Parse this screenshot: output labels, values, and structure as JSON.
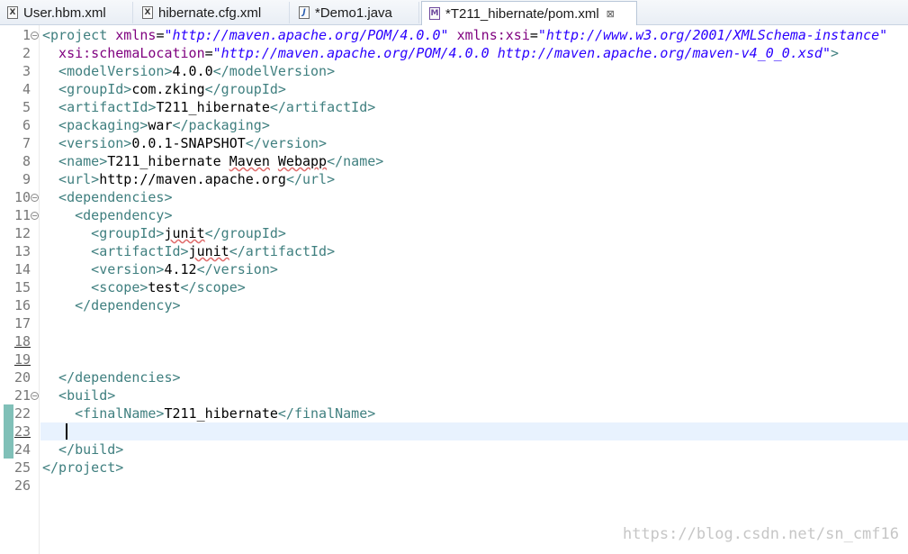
{
  "tabs": [
    {
      "icon": "xml-file-icon",
      "label": "User.hbm.xml"
    },
    {
      "icon": "xml-file-icon",
      "label": "hibernate.cfg.xml"
    },
    {
      "icon": "java-file-icon",
      "label": "*Demo1.java"
    },
    {
      "icon": "maven-pom-icon",
      "label": "*T211_hibernate/pom.xml",
      "active": true,
      "close": "⊠"
    }
  ],
  "line_numbers": [
    "1",
    "2",
    "3",
    "4",
    "5",
    "6",
    "7",
    "8",
    "9",
    "10",
    "11",
    "12",
    "13",
    "14",
    "15",
    "16",
    "17",
    "18",
    "19",
    "20",
    "21",
    "22",
    "23",
    "24",
    "25",
    "26"
  ],
  "code": {
    "l1": {
      "t1": "<project ",
      "a1": "xmlns",
      "e1": "=",
      "v1": "\"http://maven.apache.org/POM/4.0.0\"",
      "a2": " xmlns:xsi",
      "e2": "=",
      "v2": "\"http://www.w3.org/2001/XMLSchema-instance\""
    },
    "l2": {
      "a": "  xsi:schemaLocation",
      "e": "=",
      "v": "\"http://maven.apache.org/POM/4.0.0 http://maven.apache.org/maven-v4_0_0.xsd\"",
      "t": ">"
    },
    "l3": {
      "o": "  <modelVersion>",
      "x": "4.0.0",
      "c": "</modelVersion>"
    },
    "l4": {
      "o": "  <groupId>",
      "x": "com.zking",
      "c": "</groupId>"
    },
    "l5": {
      "o": "  <artifactId>",
      "x": "T211_hibernate",
      "c": "</artifactId>"
    },
    "l6": {
      "o": "  <packaging>",
      "x": "war",
      "c": "</packaging>"
    },
    "l7": {
      "o": "  <version>",
      "x": "0.0.1-SNAPSHOT",
      "c": "</version>"
    },
    "l8": {
      "o": "  <name>",
      "x1": "T211_hibernate ",
      "x2": "Maven",
      "x3": " ",
      "x4": "Webapp",
      "c": "</name>"
    },
    "l9": {
      "o": "  <url>",
      "x": "http://maven.apache.org",
      "c": "</url>"
    },
    "l10": {
      "o": "  <dependencies>"
    },
    "l11": {
      "o": "    <dependency>"
    },
    "l12": {
      "o": "      <groupId>",
      "x": "junit",
      "c": "</groupId>"
    },
    "l13": {
      "o": "      <artifactId>",
      "x": "junit",
      "c": "</artifactId>"
    },
    "l14": {
      "o": "      <version>",
      "x": "4.12",
      "c": "</version>"
    },
    "l15": {
      "o": "      <scope>",
      "x": "test",
      "c": "</scope>"
    },
    "l16": {
      "o": "    </dependency>"
    },
    "l20": {
      "o": "  </dependencies>"
    },
    "l21": {
      "o": "  <build>"
    },
    "l22": {
      "o": "    <finalName>",
      "x": "T211_hibernate",
      "c": "</finalName>"
    },
    "l24": {
      "o": "  </build>"
    },
    "l25": {
      "o": "</project>"
    }
  },
  "watermark": "https://blog.csdn.net/sn_cmf16"
}
